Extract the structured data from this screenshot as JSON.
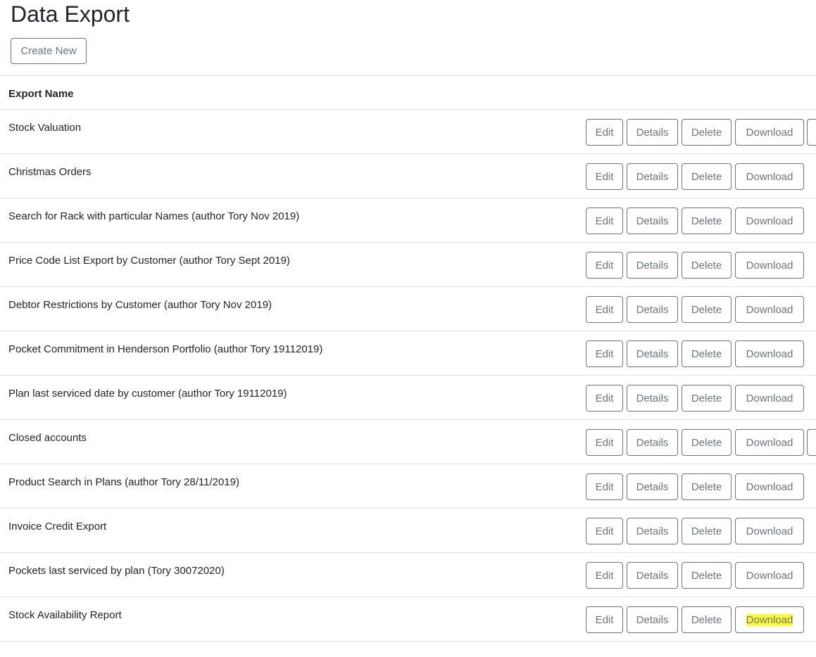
{
  "page": {
    "title": "Data Export",
    "create_button": "Create New"
  },
  "table": {
    "header": "Export Name",
    "buttons": {
      "edit": "Edit",
      "details": "Details",
      "delete": "Delete",
      "download": "Download"
    },
    "rows": [
      {
        "name": "Stock Valuation",
        "has_extra_button": true
      },
      {
        "name": "Christmas Orders",
        "has_extra_button": false
      },
      {
        "name": "Search for Rack with particular Names (author Tory Nov 2019)",
        "has_extra_button": false
      },
      {
        "name": "Price Code List Export by Customer (author Tory Sept 2019)",
        "has_extra_button": false
      },
      {
        "name": "Debtor Restrictions by Customer (author Tory Nov 2019)",
        "has_extra_button": false
      },
      {
        "name": "Pocket Commitment in Henderson Portfolio (author Tory 19112019)",
        "has_extra_button": false
      },
      {
        "name": "Plan last serviced date by customer (author Tory 19112019)",
        "has_extra_button": false
      },
      {
        "name": "Closed accounts",
        "has_extra_button": true
      },
      {
        "name": "Product Search in Plans (author Tory 28/11/2019)",
        "has_extra_button": false
      },
      {
        "name": "Invoice Credit Export",
        "has_extra_button": false
      },
      {
        "name": "Pockets last serviced by plan (Tory 30072020)",
        "has_extra_button": false
      },
      {
        "name": "Stock Availability Report",
        "has_extra_button": false,
        "download_highlighted": true
      }
    ]
  },
  "colors": {
    "button_border": "#6c757d",
    "divider": "#dee2e6",
    "highlight": "#ffff33"
  }
}
